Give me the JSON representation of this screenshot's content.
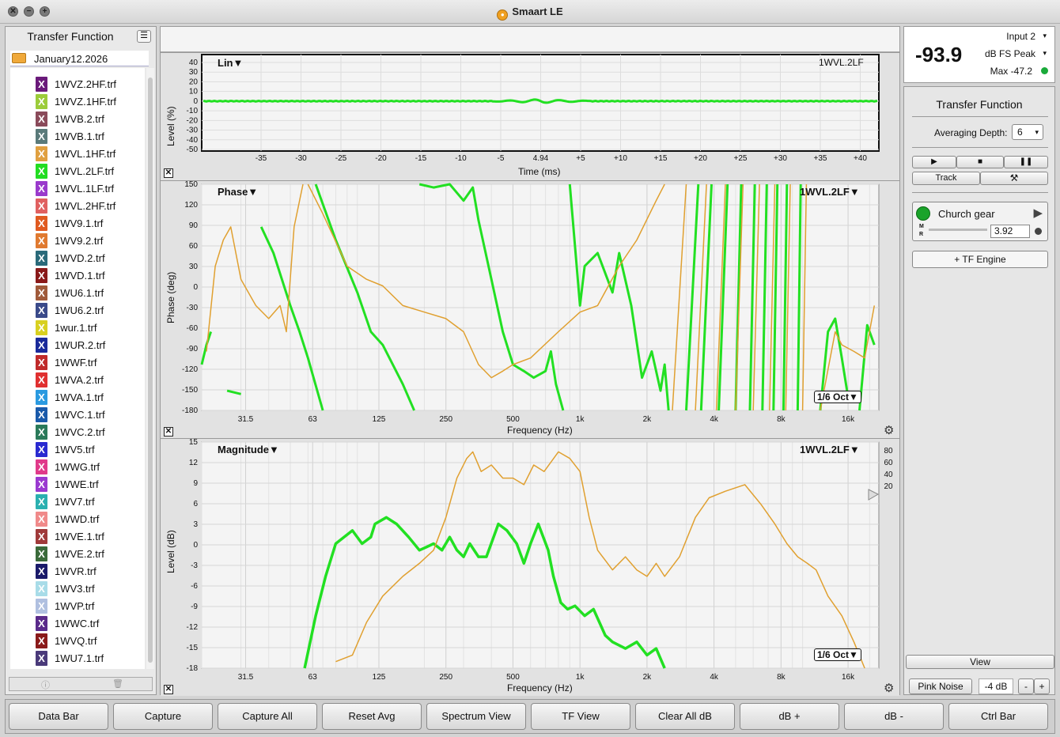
{
  "app": {
    "title": "Smaart LE"
  },
  "left_panel": {
    "title": "Transfer Function",
    "folder": "January12.2026",
    "files": [
      {
        "name": "1WVZ.2HF.trf",
        "color": "#6a1a7a"
      },
      {
        "name": "1WVZ.1HF.trf",
        "color": "#9ccc3a"
      },
      {
        "name": "1WVB.2.trf",
        "color": "#8a4a5a"
      },
      {
        "name": "1WVB.1.trf",
        "color": "#5a7a7a"
      },
      {
        "name": "1WVL.1HF.trf",
        "color": "#e0a040"
      },
      {
        "name": "1WVL.2LF.trf",
        "color": "#22dd22"
      },
      {
        "name": "1WVL.1LF.trf",
        "color": "#9a3acc"
      },
      {
        "name": "1WVL.2HF.trf",
        "color": "#e06060"
      },
      {
        "name": "1WV9.1.trf",
        "color": "#e05a20"
      },
      {
        "name": "1WV9.2.trf",
        "color": "#e07a30"
      },
      {
        "name": "1WVD.2.trf",
        "color": "#2a6a7a"
      },
      {
        "name": "1WVD.1.trf",
        "color": "#8a1a1a"
      },
      {
        "name": "1WU6.1.trf",
        "color": "#a05a3a"
      },
      {
        "name": "1WU6.2.trf",
        "color": "#3a4a8a"
      },
      {
        "name": "1wur.1.trf",
        "color": "#d8d020"
      },
      {
        "name": "1WUR.2.trf",
        "color": "#1a2a9a"
      },
      {
        "name": "1WWF.trf",
        "color": "#c02a2a"
      },
      {
        "name": "1WVA.2.trf",
        "color": "#e03030"
      },
      {
        "name": "1WVA.1.trf",
        "color": "#2a9ae0"
      },
      {
        "name": "1WVC.1.trf",
        "color": "#1a5aaa"
      },
      {
        "name": "1WVC.2.trf",
        "color": "#2a7a5a"
      },
      {
        "name": "1WV5.trf",
        "color": "#2a2ad0"
      },
      {
        "name": "1WWG.trf",
        "color": "#e03a8a"
      },
      {
        "name": "1WWE.trf",
        "color": "#9a3ad0"
      },
      {
        "name": "1WV7.trf",
        "color": "#2ab0b0"
      },
      {
        "name": "1WWD.trf",
        "color": "#f08a8a"
      },
      {
        "name": "1WVE.1.trf",
        "color": "#a03a3a"
      },
      {
        "name": "1WVE.2.trf",
        "color": "#3a6a3a"
      },
      {
        "name": "1WVR.trf",
        "color": "#1a1a6a"
      },
      {
        "name": "1WV3.trf",
        "color": "#a8dce8"
      },
      {
        "name": "1WVP.trf",
        "color": "#b0c0e0"
      },
      {
        "name": "1WWC.trf",
        "color": "#5a2a8a"
      },
      {
        "name": "1WVQ.trf",
        "color": "#8a1a1a"
      },
      {
        "name": "1WU7.1.trf",
        "color": "#4a3a7a"
      }
    ]
  },
  "impulse_plot": {
    "title": "Lin▼",
    "trace": "1WVL.2LF",
    "ylabel": "Level (%)",
    "xlabel": "Time (ms)",
    "yticks": [
      "40",
      "30",
      "20",
      "10",
      "0",
      "-10",
      "-20",
      "-30",
      "-40",
      "-50"
    ],
    "xticks": [
      "-35",
      "-30",
      "-25",
      "-20",
      "-15",
      "-10",
      "-5",
      "4.94",
      "+5",
      "+10",
      "+15",
      "+20",
      "+25",
      "+30",
      "+35",
      "+40"
    ]
  },
  "phase_plot": {
    "title": "Phase▼",
    "trace": "1WVL.2LF▼",
    "ylabel": "Phase (deg)",
    "xlabel": "Frequency (Hz)",
    "yticks": [
      "150",
      "120",
      "90",
      "60",
      "30",
      "0",
      "-30",
      "-60",
      "-90",
      "-120",
      "-150",
      "-180"
    ],
    "xticks": [
      "31.5",
      "63",
      "125",
      "250",
      "500",
      "1k",
      "2k",
      "4k",
      "8k",
      "16k"
    ],
    "smoothing": "1/6 Oct▼"
  },
  "magnitude_plot": {
    "title": "Magnitude▼",
    "trace": "1WVL.2LF▼",
    "ylabel": "Level (dB)",
    "xlabel": "Frequency (Hz)",
    "yticks": [
      "15",
      "12",
      "9",
      "6",
      "3",
      "0",
      "-3",
      "-6",
      "-9",
      "-12",
      "-15",
      "-18"
    ],
    "xticks": [
      "31.5",
      "63",
      "125",
      "250",
      "500",
      "1k",
      "2k",
      "4k",
      "8k",
      "16k"
    ],
    "coherence_ticks": [
      "80",
      "60",
      "40",
      "20"
    ],
    "smoothing": "1/6 Oct▼"
  },
  "colors": {
    "trace_green": "#22e022",
    "trace_orange": "#e0a030"
  },
  "meter": {
    "value": "-93.9",
    "input": "Input 2",
    "mode": "dB FS Peak",
    "max": "Max -47.2"
  },
  "tf_panel": {
    "title": "Transfer Function",
    "avg_label": "Averaging Depth:",
    "avg_value": "6",
    "track_label": "Track",
    "measurement": "Church gear",
    "m_label": "M",
    "r_label": "R",
    "delay_value": "3.92",
    "add_engine": "+ TF Engine",
    "view_label": "View",
    "pink_noise": "Pink Noise",
    "noise_level": "-4 dB",
    "minus": "-",
    "plus": "+"
  },
  "bottom_buttons": [
    "Data Bar",
    "Capture",
    "Capture All",
    "Reset Avg",
    "Spectrum View",
    "TF View",
    "Clear All dB",
    "dB +",
    "dB -",
    "Ctrl Bar"
  ]
}
